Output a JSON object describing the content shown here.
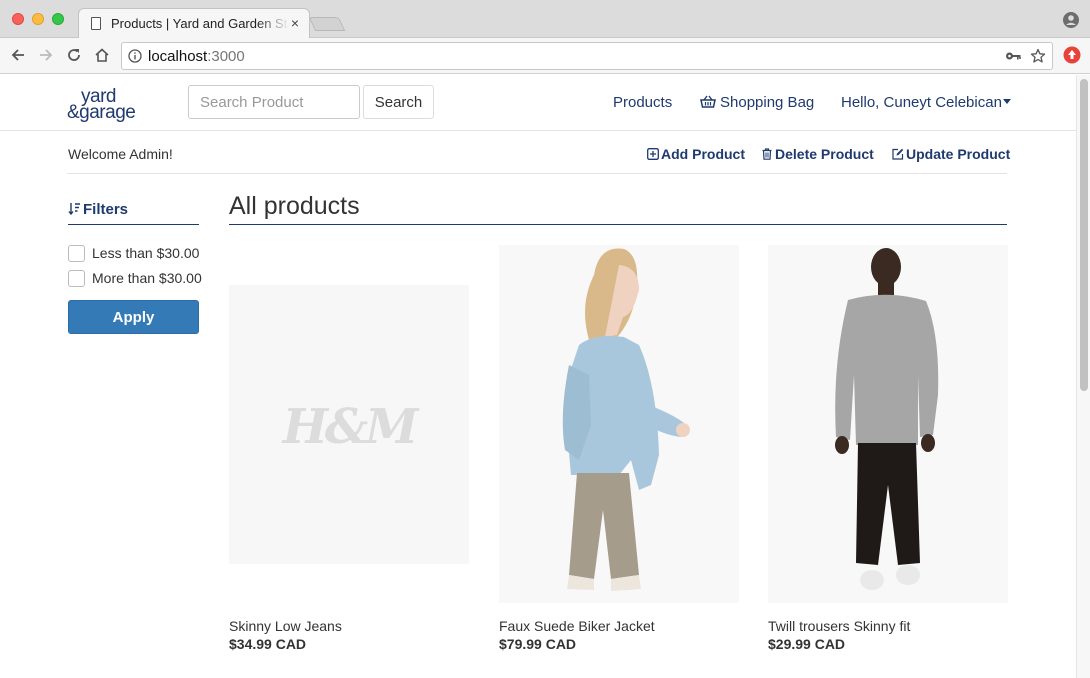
{
  "browser": {
    "tab_title": "Products | Yard and Garden Store",
    "tab_close": "×",
    "url_host": "localhost",
    "url_port": ":3000"
  },
  "navbar": {
    "logo_text": "yard & garage",
    "search_placeholder": "Search Product",
    "search_button": "Search",
    "products_link": "Products",
    "bag_link": "Shopping Bag",
    "user_menu": "Hello, Cuneyt Celebican"
  },
  "admin": {
    "welcome": "Welcome Admin!",
    "add": "Add Product",
    "delete": "Delete Product",
    "update": "Update Product"
  },
  "filters": {
    "title": "Filters",
    "options": [
      {
        "label": "Less than $30.00",
        "checked": false
      },
      {
        "label": "More than $30.00",
        "checked": false
      }
    ],
    "apply": "Apply"
  },
  "main": {
    "title": "All products",
    "products": [
      {
        "name": "Skinny Low Jeans",
        "price": "$34.99 CAD",
        "image": "hm-placeholder-logo"
      },
      {
        "name": "Faux Suede Biker Jacket",
        "price": "$79.99 CAD",
        "image": "woman-in-light-blue-biker-jacket"
      },
      {
        "name": "Twill trousers Skinny fit",
        "price": "$29.99 CAD",
        "image": "man-in-grey-sweater-and-black-trousers"
      }
    ]
  },
  "colors": {
    "brand_navy": "#1f3a6f",
    "apply_blue": "#337ab7"
  }
}
